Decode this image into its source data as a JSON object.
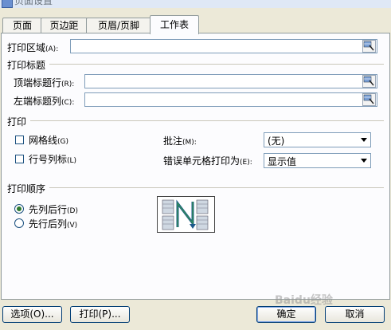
{
  "window": {
    "title": "页面设置"
  },
  "tabs": [
    {
      "label": "页面",
      "active": false
    },
    {
      "label": "页边距",
      "active": false
    },
    {
      "label": "页眉/页脚",
      "active": false
    },
    {
      "label": "工作表",
      "active": true
    }
  ],
  "print_area": {
    "label": "打印区域",
    "mnemonic": "(A):",
    "value": ""
  },
  "print_titles": {
    "heading": "打印标题",
    "top_rows": {
      "label": "顶端标题行",
      "mnemonic": "(R):",
      "value": ""
    },
    "left_cols": {
      "label": "左端标题列",
      "mnemonic": "(C):",
      "value": ""
    }
  },
  "print": {
    "heading": "打印",
    "gridlines": {
      "label": "网格线",
      "mnemonic": "(G)",
      "checked": false
    },
    "row_col_headers": {
      "label": "行号列标",
      "mnemonic": "(L)",
      "checked": false
    },
    "comments": {
      "label": "批注",
      "mnemonic": "(M):",
      "value": "(无)"
    },
    "errors": {
      "label": "错误单元格打印为",
      "mnemonic": "(E):",
      "value": "显示值"
    }
  },
  "page_order": {
    "heading": "打印顺序",
    "down_then_over": {
      "label": "先列后行",
      "mnemonic": "(D)",
      "selected": true
    },
    "over_then_down": {
      "label": "先行后列",
      "mnemonic": "(V)",
      "selected": false
    }
  },
  "buttons": {
    "options": "选项(O)...",
    "print": "打印(P)...",
    "ok": "确定",
    "cancel": "取消"
  },
  "watermark": "Baidu经验",
  "colors": {
    "accent": "#003c74",
    "panel": "#fcfcfe",
    "dialog": "#ece9d8"
  }
}
